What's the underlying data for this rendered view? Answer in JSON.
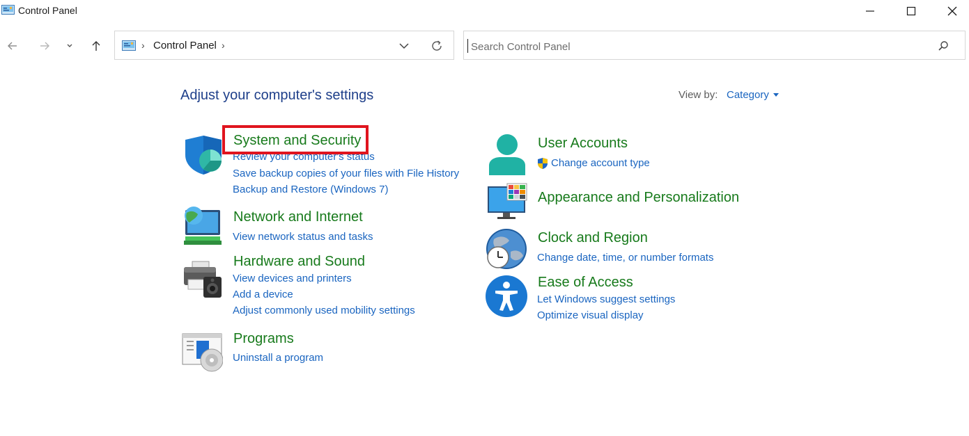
{
  "window": {
    "title": "Control Panel"
  },
  "address": {
    "crumbs": [
      "Control Panel"
    ]
  },
  "search": {
    "placeholder": "Search Control Panel",
    "value": ""
  },
  "main": {
    "heading": "Adjust your computer's settings",
    "view_by_label": "View by:",
    "view_by_value": "Category"
  },
  "categories": {
    "system_security": {
      "title": "System and Security",
      "links": [
        "Review your computer's status",
        "Save backup copies of your files with File History",
        "Backup and Restore (Windows 7)"
      ],
      "icon": "shield-icon"
    },
    "network": {
      "title": "Network and Internet",
      "links": [
        "View network status and tasks"
      ],
      "icon": "network-globe-icon"
    },
    "hardware": {
      "title": "Hardware and Sound",
      "links": [
        "View devices and printers",
        "Add a device",
        "Adjust commonly used mobility settings"
      ],
      "icon": "printer-speaker-icon"
    },
    "programs": {
      "title": "Programs",
      "links": [
        "Uninstall a program"
      ],
      "icon": "programs-disc-icon"
    },
    "user_accounts": {
      "title": "User Accounts",
      "links": [
        "Change account type"
      ],
      "icon": "user-icon"
    },
    "appearance": {
      "title": "Appearance and Personalization",
      "links": [],
      "icon": "monitor-palette-icon"
    },
    "clock": {
      "title": "Clock and Region",
      "links": [
        "Change date, time, or number formats"
      ],
      "icon": "globe-clock-icon"
    },
    "ease": {
      "title": "Ease of Access",
      "links": [
        "Let Windows suggest settings",
        "Optimize visual display"
      ],
      "icon": "accessibility-icon"
    }
  },
  "colors": {
    "heading_blue": "#1e3f8a",
    "category_green": "#177a1b",
    "link_blue": "#1a65c0",
    "highlight_red": "#e0141e"
  }
}
